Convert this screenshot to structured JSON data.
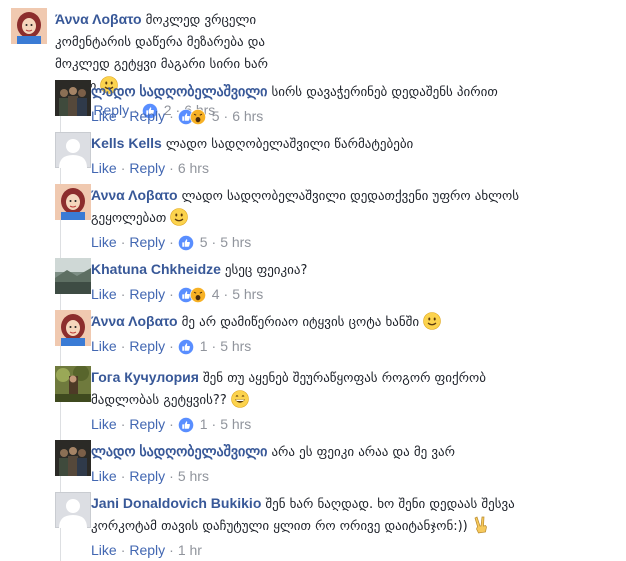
{
  "actions": {
    "like_label": "Like",
    "reply_label": "Reply"
  },
  "comments": [
    {
      "author": "Άννα Λοβατο",
      "text": "მოკლედ ვრცელი კომენტარის დაწერა მეზარება და მოკლედ გეტყვი მაგარი სირი ხარ ლადო",
      "emoji": "slightly-smiling-face",
      "reactions": "like",
      "count": "2",
      "time": "6 hrs",
      "avatar": "drawn-girl"
    },
    {
      "author": "ლადო სადღობელაშვილი",
      "text": "სირს დავაჭერინებ დედაშენს პირით",
      "reactions": "like-wow",
      "count": "5",
      "time": "6 hrs",
      "avatar": "group-photo"
    },
    {
      "author": "Kells Kells",
      "text": "ლადო სადღობელაშვილი წარმატებები",
      "time": "6 hrs",
      "avatar": "default-silhouette"
    },
    {
      "author": "Άννα Λοβατο",
      "text": "ლადო სადღობელაშვილი დედათქვენი უფრო ახლოს გეყოლებათ",
      "emoji": "slightly-smiling-face",
      "reactions": "like",
      "count": "5",
      "time": "5 hrs",
      "avatar": "drawn-girl"
    },
    {
      "author": "Khatuna Chkheidze",
      "text": "ესეც ფეიკია?",
      "reactions": "like-wow",
      "count": "4",
      "time": "5 hrs",
      "avatar": "landscape"
    },
    {
      "author": "Άννα Λοβατο",
      "text": "მე არ დამიწერიაო იტყვის ცოტა ხანში",
      "emoji": "slightly-smiling-face",
      "reactions": "like",
      "count": "1",
      "time": "5 hrs",
      "avatar": "drawn-girl"
    },
    {
      "author": "Гога Кучулория",
      "text": "შენ თუ აყენებ შეურაწყოფას როგორ ფიქრობ მადლობას გეტყვის??",
      "emoji": "grinning-face",
      "reactions": "like",
      "count": "1",
      "time": "5 hrs",
      "avatar": "forest-photo"
    },
    {
      "author": "ლადო სადღობელაშვილი",
      "text": "არა ეს ფეიკი არაა და მე ვარ",
      "time": "5 hrs",
      "avatar": "group-photo"
    },
    {
      "author": "Jani Donaldovich Bukikio",
      "text": "შენ ხარ ნაღდად. ხო შენი დედაას შესვა კორკოტამ თავის დაჩუტული ყლით რო ორივე დაიტანჯონ:))",
      "emoji": "victory-hand",
      "time": "1 hr",
      "avatar": "default-silhouette"
    }
  ],
  "colors": {
    "link": "#4267b2",
    "author": "#385898",
    "meta": "#90949c",
    "text": "#1d2129",
    "like": "#598eff",
    "wow": "#f7b125",
    "line": "#dddfe2"
  }
}
